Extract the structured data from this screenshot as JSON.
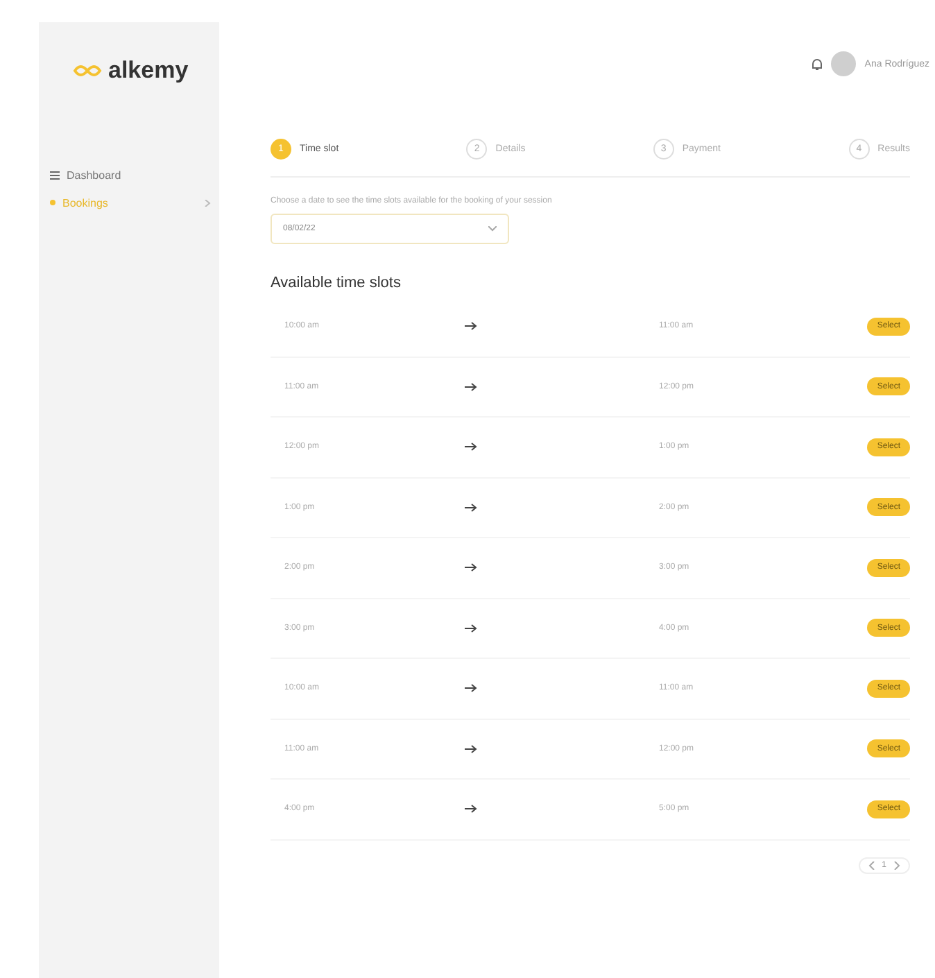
{
  "brand": {
    "name": "alkemy"
  },
  "sidebar": {
    "items": [
      {
        "label": "Dashboard",
        "selected": false,
        "kind": "menu"
      },
      {
        "label": "Bookings",
        "selected": true,
        "kind": "dot"
      }
    ]
  },
  "header": {
    "user_name": "Ana Rodríguez"
  },
  "steps": [
    {
      "label": "Time slot",
      "number": "1",
      "selected": true
    },
    {
      "label": "Details",
      "number": "2",
      "selected": false
    },
    {
      "label": "Payment",
      "number": "3",
      "selected": false
    },
    {
      "label": "Results",
      "number": "4",
      "selected": false
    }
  ],
  "date_picker": {
    "label": "Choose a date to see the time slots available for the booking of your session",
    "value": "08/02/22"
  },
  "slots_title": "Available time slots",
  "slots": [
    {
      "start": "10:00 am",
      "end": "11:00 am",
      "action": "Select"
    },
    {
      "start": "11:00 am",
      "end": "12:00 pm",
      "action": "Select"
    },
    {
      "start": "12:00 pm",
      "end": "1:00 pm",
      "action": "Select"
    },
    {
      "start": "1:00 pm",
      "end": "2:00 pm",
      "action": "Select"
    },
    {
      "start": "2:00 pm",
      "end": "3:00 pm",
      "action": "Select"
    },
    {
      "start": "3:00 pm",
      "end": "4:00 pm",
      "action": "Select"
    },
    {
      "start": "10:00 am",
      "end": "11:00 am",
      "action": "Select"
    },
    {
      "start": "11:00 am",
      "end": "12:00 pm",
      "action": "Select"
    },
    {
      "start": "4:00 pm",
      "end": "5:00 pm",
      "action": "Select"
    }
  ],
  "pagination": {
    "page": "1"
  }
}
